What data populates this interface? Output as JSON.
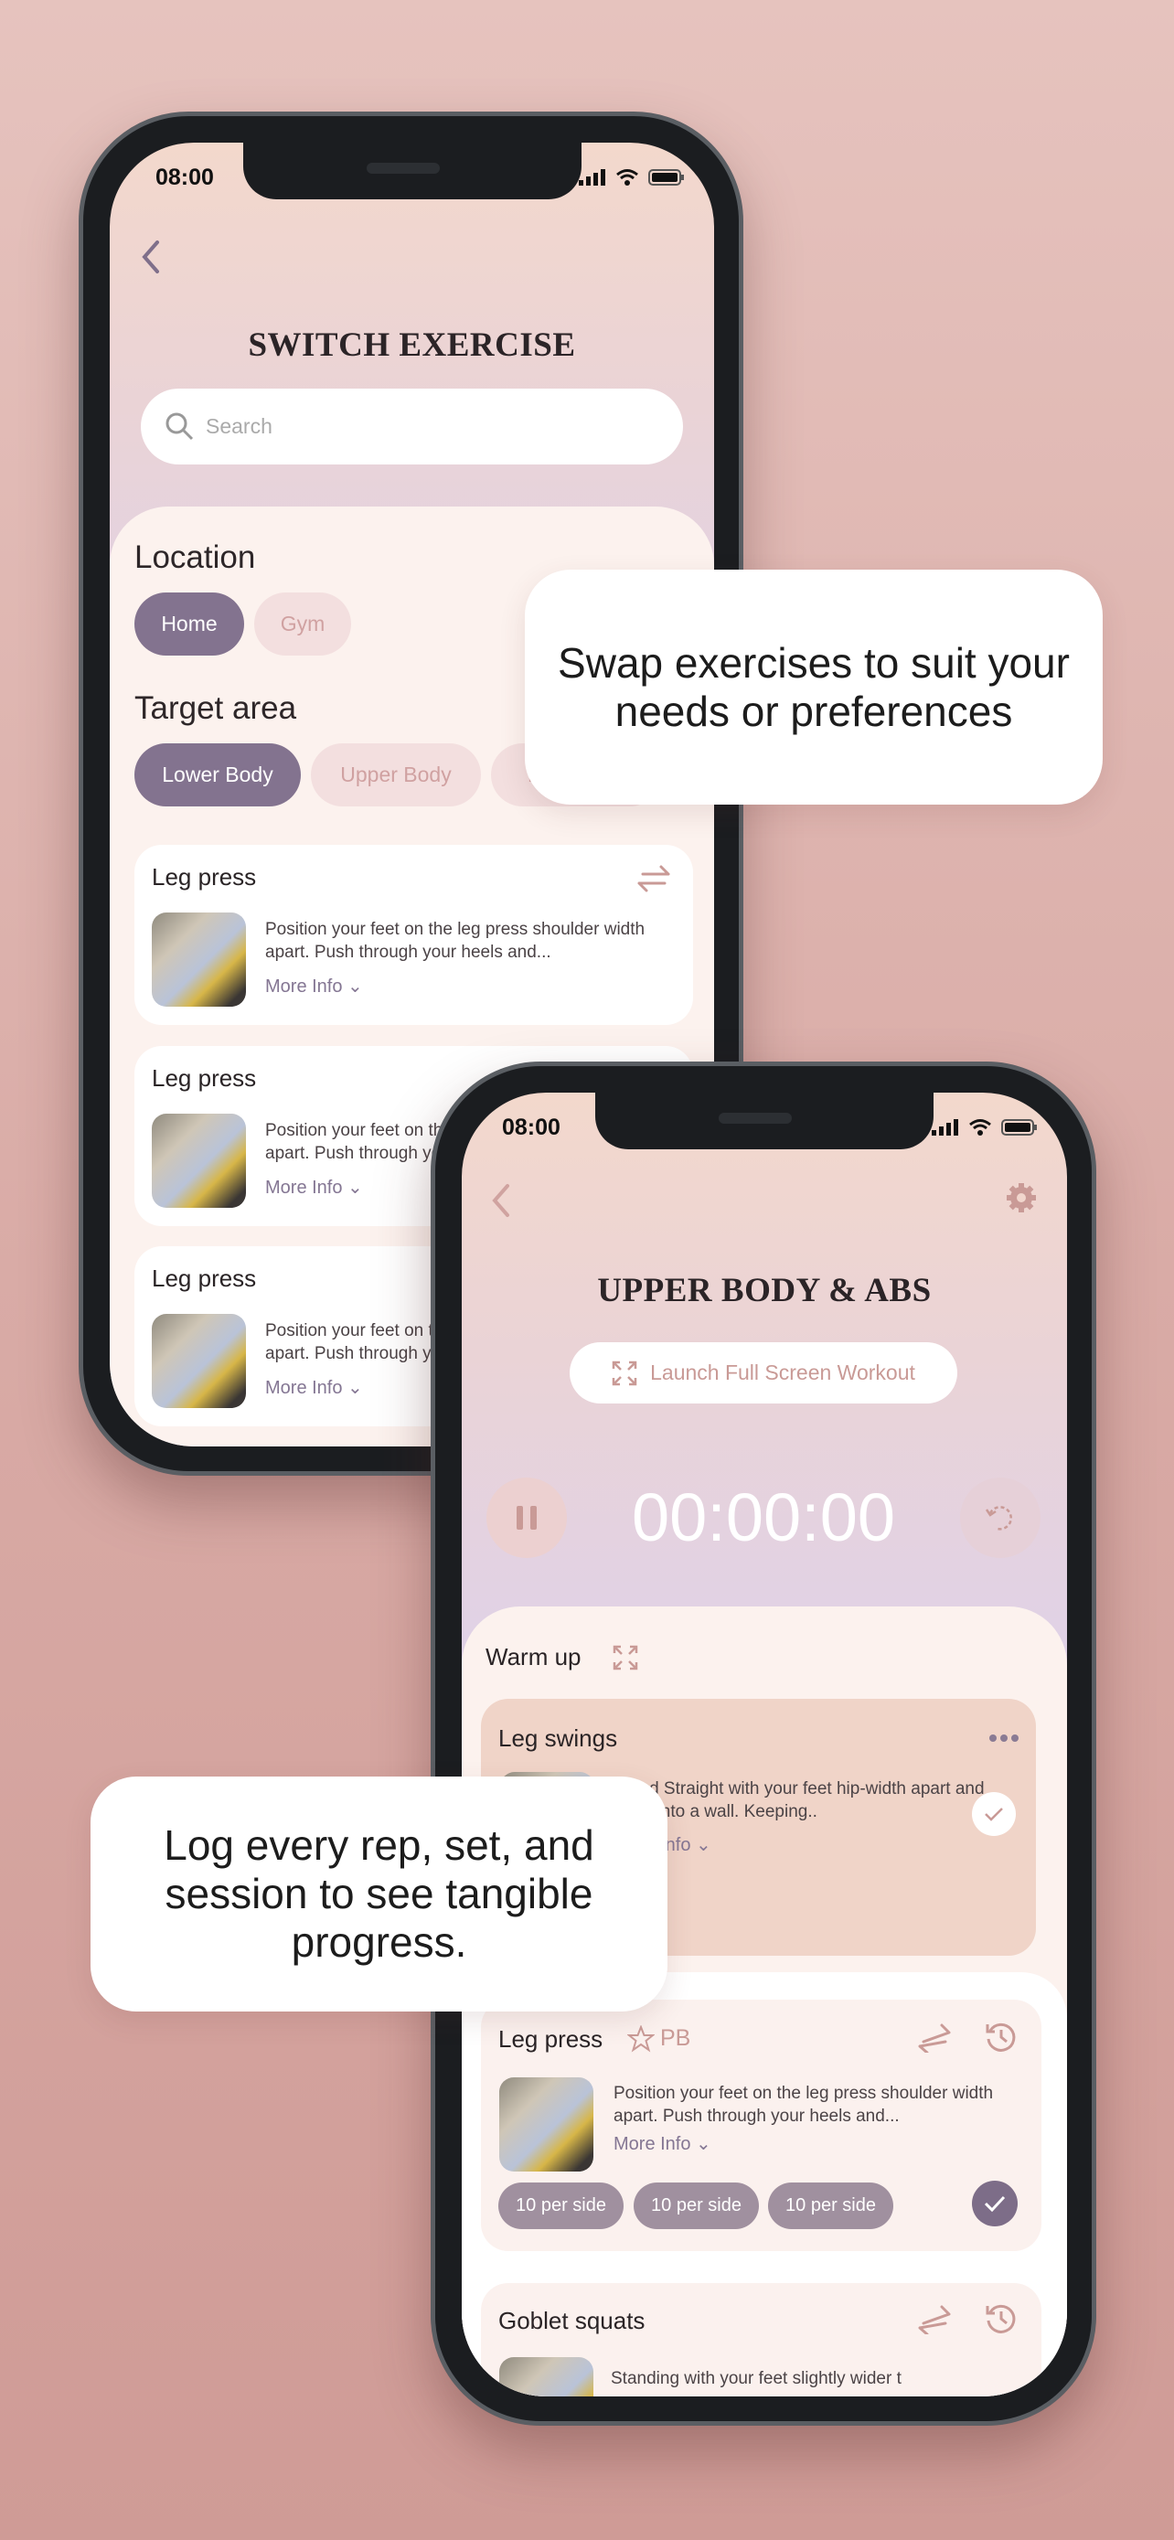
{
  "colors": {
    "accent": "#83738f",
    "rose": "#c99a96",
    "card_highlight": "#f0d4c8",
    "panel": "#fcf2ee"
  },
  "phone1": {
    "status_time": "08:00",
    "title": "SWITCH EXERCISE",
    "search": {
      "placeholder": "Search",
      "icon": "search-icon"
    },
    "location": {
      "label": "Location",
      "options": [
        {
          "label": "Home",
          "selected": true
        },
        {
          "label": "Gym",
          "selected": false
        }
      ]
    },
    "target_area": {
      "label": "Target area",
      "options": [
        {
          "label": "Lower Body",
          "selected": true
        },
        {
          "label": "Upper Body",
          "selected": false
        },
        {
          "label": "F",
          "selected": false
        }
      ]
    },
    "exercises": [
      {
        "name": "Leg press",
        "description": "Position your feet on the leg press shoulder width apart. Push through your heels and...",
        "more": "More Info"
      },
      {
        "name": "Leg press",
        "description": "Position your feet on the leg press shoulder width apart. Push through your heels and...",
        "more": "More Info"
      },
      {
        "name": "Leg press",
        "description": "Position your feet on the leg press shoulder width apart. Push through your heels and...",
        "more": "More Info"
      }
    ]
  },
  "callout1": "Swap exercises to suit your needs or preferences",
  "callout2": "Log every rep, set, and session to see tangible progress.",
  "phone2": {
    "status_time": "08:00",
    "title": "UPPER BODY & ABS",
    "launch_label": "Launch Full Screen Workout",
    "timer": "00:00:00",
    "section": "Warm up",
    "warmup": {
      "name": "Leg swings",
      "description": "Stand Straight with your feet hip-width apart and hold onto a wall. Keeping..",
      "more": "More Info",
      "completed": true
    },
    "leg_press": {
      "name": "Leg press",
      "badge": "PB",
      "description": "Position your feet on the leg press shoulder width apart. Push through your heels and...",
      "more": "More Info",
      "sets": [
        "10 per side",
        "10 per side",
        "10 per side"
      ],
      "completed": true
    },
    "goblet": {
      "name": "Goblet squats",
      "description": "Standing with your feet slightly wider t"
    }
  }
}
